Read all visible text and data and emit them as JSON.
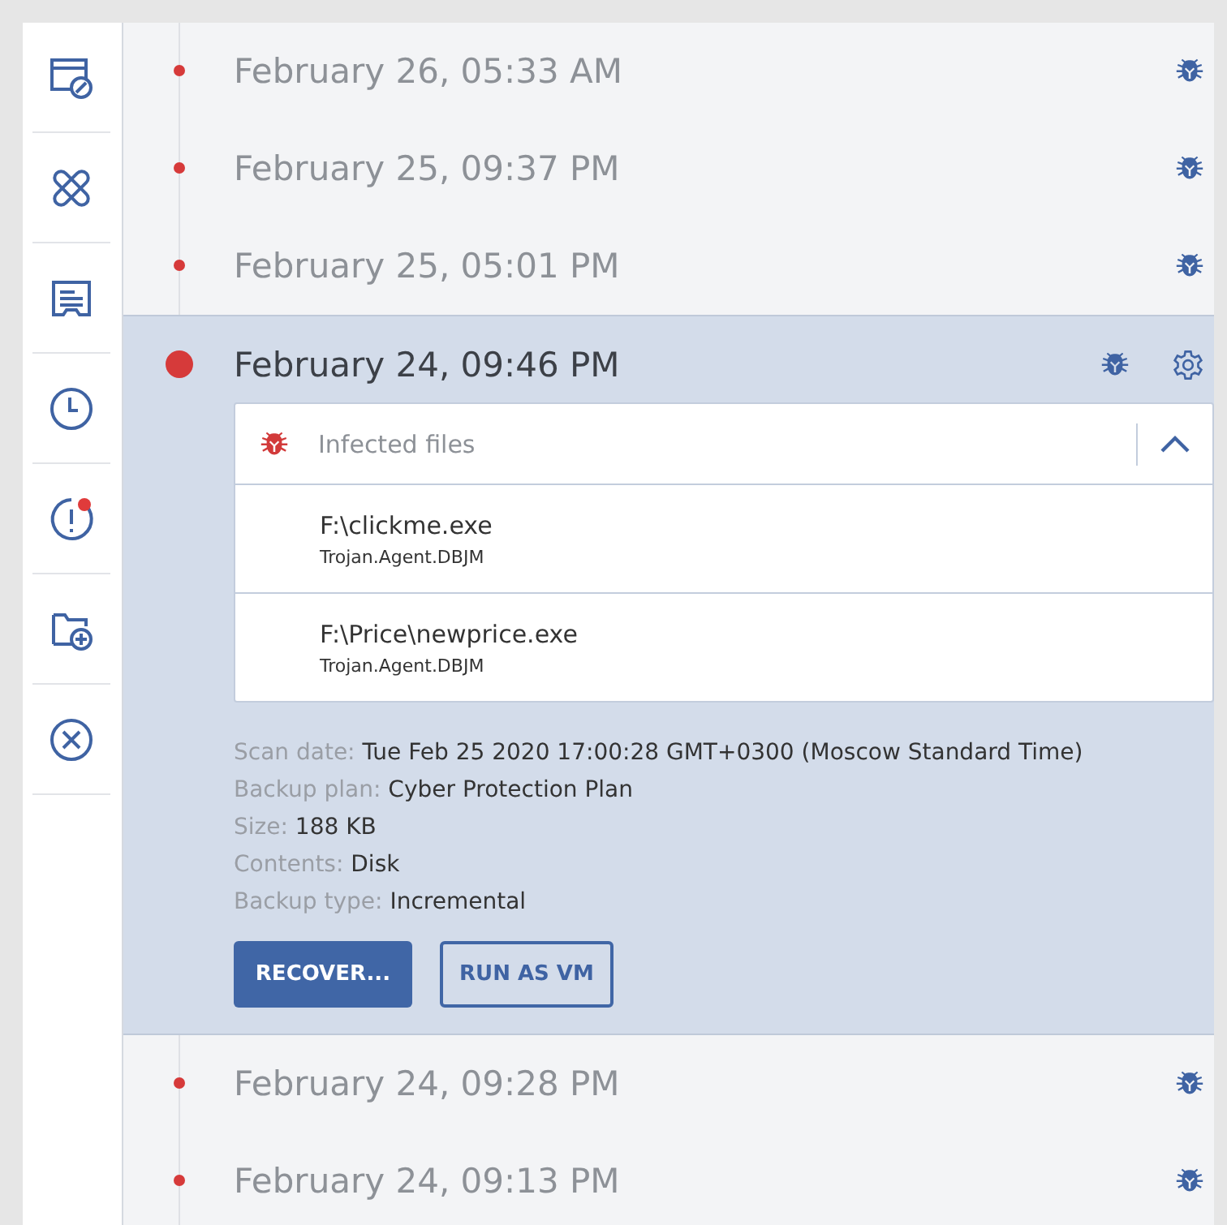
{
  "sidebar": {
    "items": [
      {
        "kind": "remote",
        "alert": false
      },
      {
        "kind": "patch",
        "alert": false
      },
      {
        "kind": "ticket",
        "alert": false
      },
      {
        "kind": "clock",
        "alert": false
      },
      {
        "kind": "warning",
        "alert": true
      },
      {
        "kind": "folder-add",
        "alert": false
      },
      {
        "kind": "cancel",
        "alert": false
      }
    ]
  },
  "backups": [
    {
      "date": "February 26, 05:33 AM",
      "selected": false
    },
    {
      "date": "February 25, 09:37 PM",
      "selected": false
    },
    {
      "date": "February 25, 05:01 PM",
      "selected": false
    },
    {
      "date": "February 24, 09:46 PM",
      "selected": true,
      "infected": {
        "title": "Infected files",
        "expanded": true,
        "files": [
          {
            "path": "F:\\clickme.exe",
            "threat": "Trojan.Agent.DBJM"
          },
          {
            "path": "F:\\Price\\newprice.exe",
            "threat": "Trojan.Agent.DBJM"
          }
        ]
      },
      "details": [
        {
          "label": "Scan date:",
          "value": "Tue Feb 25 2020 17:00:28 GMT+0300 (Moscow Standard Time)"
        },
        {
          "label": "Backup plan:",
          "value": "Cyber Protection Plan"
        },
        {
          "label": "Size:",
          "value": "188 KB"
        },
        {
          "label": "Contents:",
          "value": "Disk"
        },
        {
          "label": "Backup type:",
          "value": "Incremental"
        }
      ],
      "buttons": [
        {
          "label": "RECOVER...",
          "kind": "primary"
        },
        {
          "label": "RUN AS VM",
          "kind": "secondary"
        }
      ]
    },
    {
      "date": "February 24, 09:28 PM",
      "selected": false
    },
    {
      "date": "February 24, 09:13 PM",
      "selected": false
    }
  ]
}
